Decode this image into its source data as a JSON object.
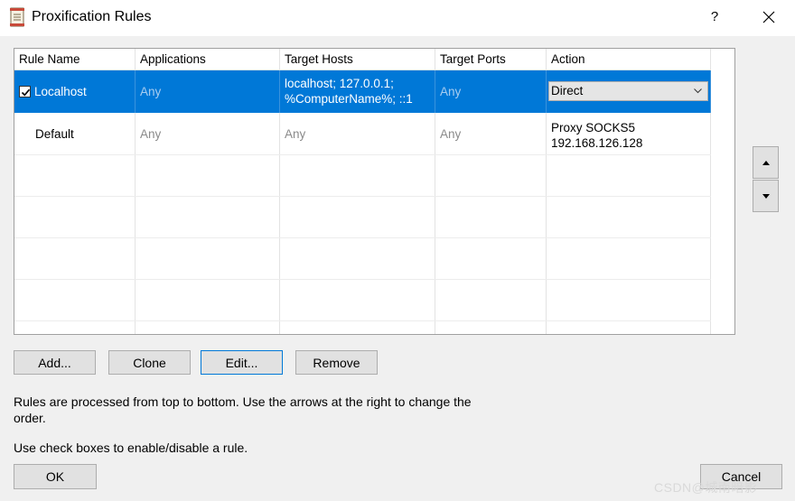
{
  "window": {
    "title": "Proxification Rules",
    "help_label": "?"
  },
  "table": {
    "columns": [
      "Rule Name",
      "Applications",
      "Target Hosts",
      "Target Ports",
      "Action"
    ],
    "rows": [
      {
        "name": "Localhost",
        "enabled": true,
        "applications": "Any",
        "hosts_line1": "localhost; 127.0.0.1;",
        "hosts_line2": "%ComputerName%; ::1",
        "ports": "Any",
        "action": "Direct"
      },
      {
        "name": "Default",
        "applications": "Any",
        "hosts": "Any",
        "ports": "Any",
        "action_line1": "Proxy SOCKS5",
        "action_line2": "192.168.126.128"
      }
    ]
  },
  "buttons": {
    "add": "Add...",
    "clone": "Clone",
    "edit": "Edit...",
    "remove": "Remove",
    "ok": "OK",
    "cancel": "Cancel"
  },
  "info": {
    "line1": "Rules are processed from top to bottom. Use the arrows at the right to change the order.",
    "line2": "Use check boxes to enable/disable a rule."
  },
  "watermark": "CSDN@城南暗影",
  "colors": {
    "selection": "#0078d7",
    "window_bg": "#f0f0f0",
    "button_bg": "#e1e1e1"
  }
}
